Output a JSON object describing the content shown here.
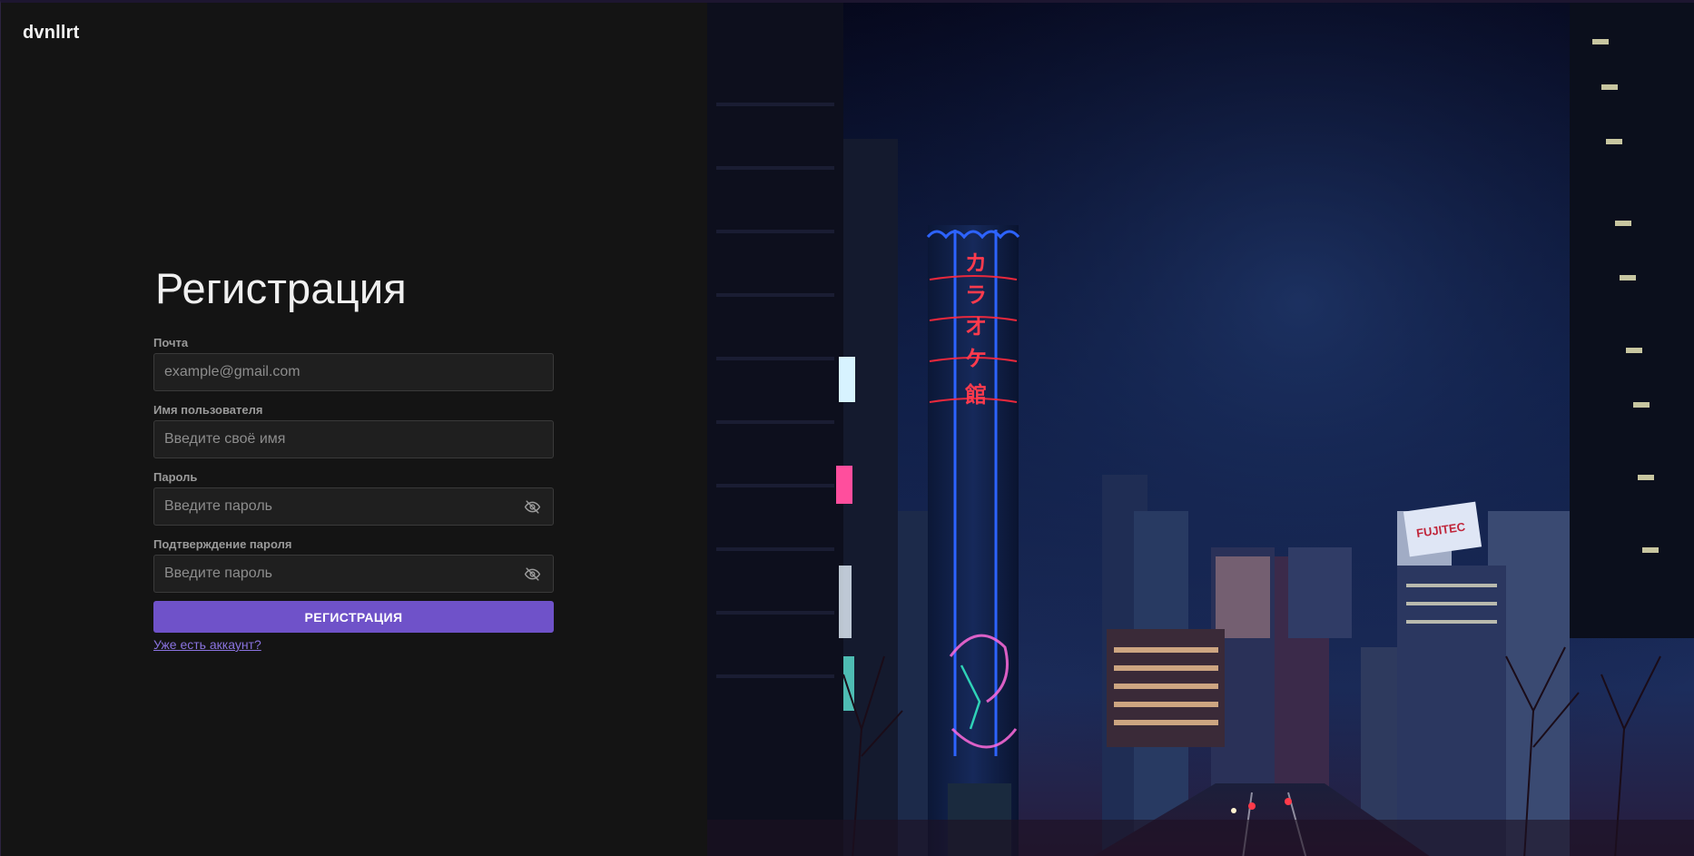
{
  "brand": {
    "name": "dvnllrt"
  },
  "form": {
    "title": "Регистрация",
    "fields": {
      "email": {
        "label": "Почта",
        "placeholder": "example@gmail.com",
        "value": ""
      },
      "username": {
        "label": "Имя пользователя",
        "placeholder": "Введите своё имя",
        "value": ""
      },
      "password": {
        "label": "Пароль",
        "placeholder": "Введите пароль",
        "value": "",
        "icon": "eye-off-icon"
      },
      "password_confirm": {
        "label": "Подтверждение пароля",
        "placeholder": "Введите пароль",
        "value": "",
        "icon": "eye-off-icon"
      }
    },
    "submit_label": "РЕГИСТРАЦИЯ",
    "login_link": "Уже есть аккаунт?"
  },
  "hero": {
    "image": "night-city-neon-photo",
    "sign_text": "カラオケ館"
  },
  "colors": {
    "accent": "#6f52c9",
    "link": "#8a73e0",
    "panel": "#141414"
  }
}
